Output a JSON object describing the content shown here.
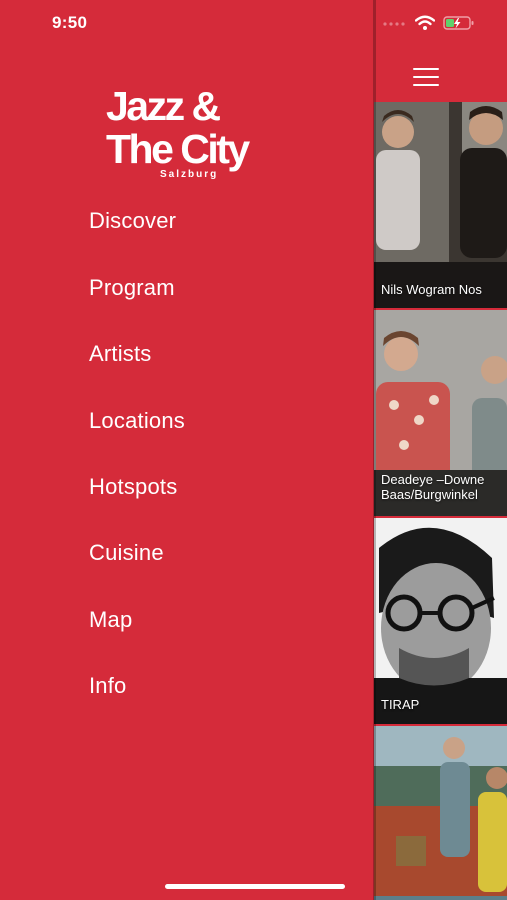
{
  "status_bar": {
    "time": "9:50"
  },
  "logo": {
    "line1": "Jazz &",
    "line2": "The City",
    "line3": "Salzburg"
  },
  "menu": {
    "items": [
      {
        "label": "Discover"
      },
      {
        "label": "Program"
      },
      {
        "label": "Artists"
      },
      {
        "label": "Locations"
      },
      {
        "label": "Hotspots"
      },
      {
        "label": "Cuisine"
      },
      {
        "label": "Map"
      },
      {
        "label": "Info"
      }
    ]
  },
  "feed": {
    "cards": [
      {
        "lines": [
          "Nils Wogram Nos"
        ]
      },
      {
        "lines": [
          "Deadeye –Downe",
          "Baas/Burgwinkel"
        ]
      },
      {
        "lines": [
          "TIRAP"
        ]
      },
      {
        "lines": [
          ""
        ]
      }
    ]
  },
  "colors": {
    "brand_red": "#d52b3a",
    "text": "#ffffff"
  },
  "icons": [
    "menu-icon",
    "wifi-icon",
    "battery-charging-icon",
    "signal-icon"
  ]
}
